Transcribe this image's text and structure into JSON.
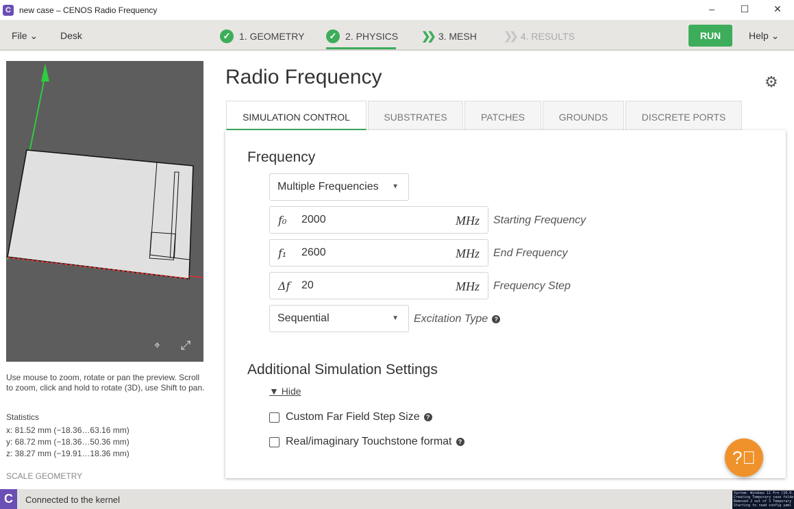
{
  "window": {
    "title": "new case – CENOS Radio Frequency",
    "minimize": "–",
    "maximize": "☐",
    "close": "✕"
  },
  "menu": {
    "file": "File ⌄",
    "desk": "Desk",
    "run": "RUN",
    "help": "Help ⌄"
  },
  "steps": [
    {
      "label": "1. GEOMETRY",
      "state": "done"
    },
    {
      "label": "2. PHYSICS",
      "state": "active"
    },
    {
      "label": "3. MESH",
      "state": "next"
    },
    {
      "label": "4. RESULTS",
      "state": "disabled"
    }
  ],
  "preview": {
    "help": "Use mouse to zoom, rotate or pan the preview. Scroll to zoom, click and hold to rotate (3D), use Shift to pan.",
    "stats_title": "Statistics",
    "stats": [
      "x: 81.52 mm  (−18.36…63.16 mm)",
      "y: 68.72 mm  (−18.36…50.36 mm)",
      "z: 38.27 mm  (−19.91…18.36 mm)"
    ],
    "scale": "SCALE GEOMETRY"
  },
  "main": {
    "title": "Radio Frequency",
    "tabs": [
      "SIMULATION CONTROL",
      "SUBSTRATES",
      "PATCHES",
      "GROUNDS",
      "DISCRETE PORTS"
    ],
    "frequency": {
      "heading": "Frequency",
      "mode": "Multiple Frequencies",
      "fields": [
        {
          "symbol": "f₀",
          "value": "2000",
          "unit": "MHz",
          "label": "Starting Frequency"
        },
        {
          "symbol": "f₁",
          "value": "2600",
          "unit": "MHz",
          "label": "End Frequency"
        },
        {
          "symbol": "Δf",
          "value": "20",
          "unit": "MHz",
          "label": "Frequency Step"
        }
      ],
      "excitation": "Sequential",
      "excitation_label": "Excitation Type"
    },
    "additional": {
      "heading": "Additional Simulation Settings",
      "toggle": "▼ Hide",
      "options": [
        "Custom Far Field Step Size",
        "Real/imaginary Touchstone format"
      ]
    }
  },
  "status": {
    "text": "Connected to the kernel",
    "console": [
      "System: Windows 11 Pro (10.0.",
      "Creating Temporary case folde",
      "Removed 2 out of 3 Temporary",
      "Starting to read config yaml"
    ]
  },
  "colors": {
    "accent": "#3ead5b",
    "brand": "#6a4fb5",
    "help_fab": "#f0922b"
  }
}
